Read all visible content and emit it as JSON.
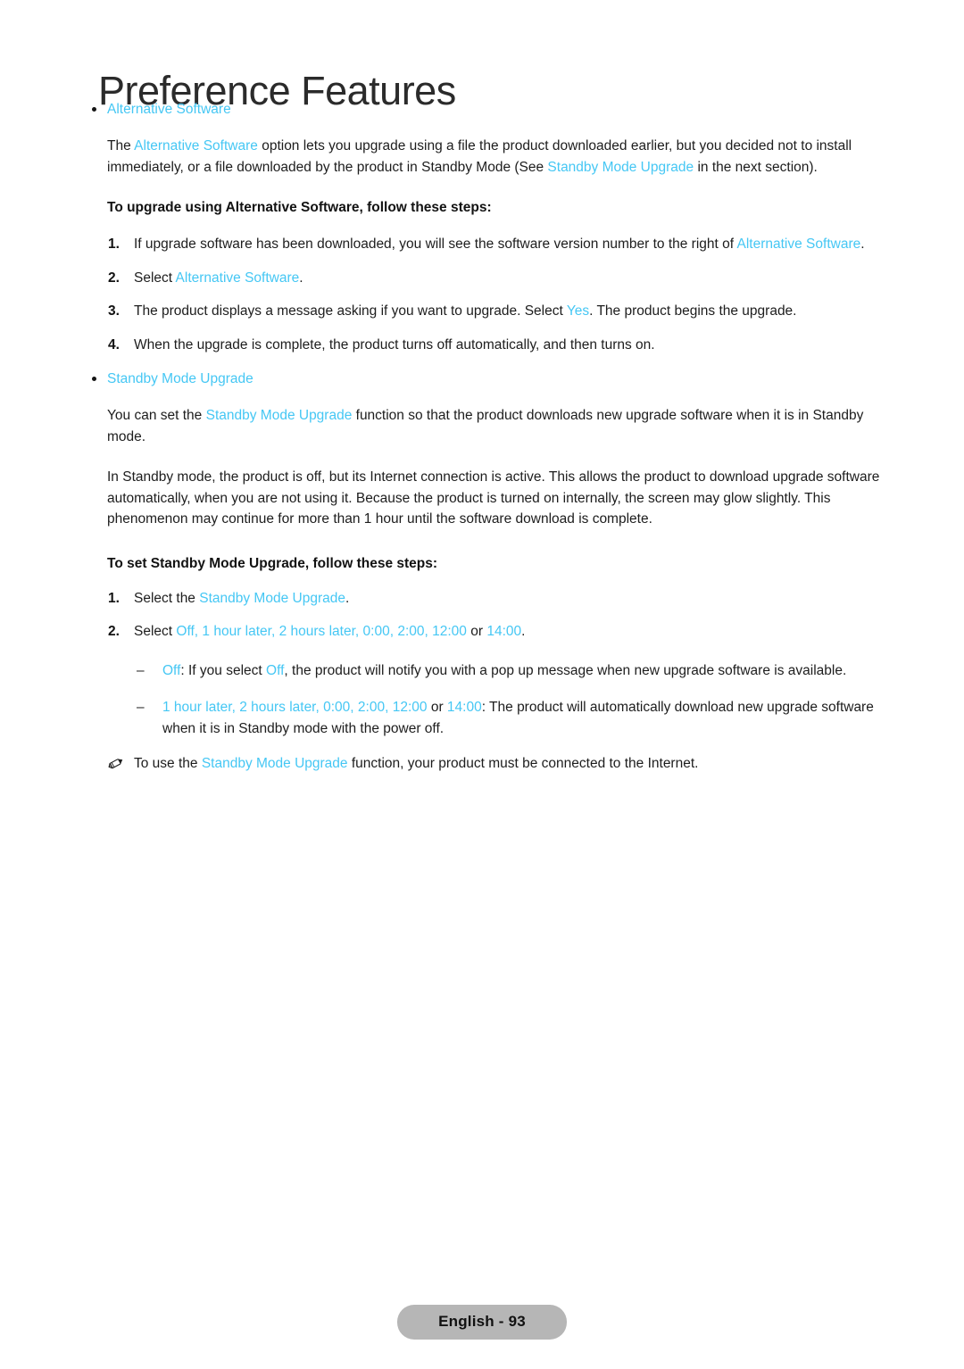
{
  "document": {
    "title": "Preference Features",
    "accent_color": "#45c7f4",
    "text_color": "#1d1d1d",
    "background_color": "#ffffff"
  },
  "terms": {
    "alternative_software": "Alternative Software",
    "standby_mode_upgrade": "Standby Mode Upgrade",
    "yes": "Yes",
    "off": "Off",
    "one_hour_later": "1 hour later",
    "two_hours_later": "2 hours later",
    "t0000": "0:00",
    "t0200": "2:00",
    "t1200": "12:00",
    "t1400": "14:00"
  },
  "sections": [
    {
      "heading": "Alternative Software",
      "intro": {
        "p1": "The ",
        "p2": " option lets you upgrade using a file the product downloaded earlier, but you decided not to install immediately, or a file downloaded by the product in Standby Mode (See ",
        "p3": " in the next section)."
      },
      "steps_title": "To upgrade using Alternative Software, follow these steps:",
      "steps": [
        {
          "num": "1.",
          "a": "If upgrade software has been downloaded, you will see the software version number to the right of ",
          "b": "Alternative Software",
          "c": "."
        },
        {
          "num": "2.",
          "a": "Select ",
          "b": "Alternative Software",
          "c": "."
        },
        {
          "num": "3.",
          "a": "The product displays a message asking if you want to upgrade. Select ",
          "b": "Yes",
          "c": ". The product begins the upgrade."
        },
        {
          "num": "4.",
          "a": "When the upgrade is complete, the product turns off automatically, and then turns on.",
          "b": "",
          "c": ""
        }
      ]
    },
    {
      "heading": "Standby Mode Upgrade",
      "para1": {
        "p1": "You can set the ",
        "p2": "Standby Mode Upgrade",
        "p3": " function so that the product downloads new upgrade software when it is in Standby mode."
      },
      "para2": "In Standby mode, the product is off, but its Internet connection is active. This allows the product to download upgrade software automatically, when you are not using it. Because the product is turned on internally, the screen may glow slightly. This phenomenon may continue for more than 1 hour until the software download is complete.",
      "steps_title": "To set Standby Mode Upgrade, follow these steps:",
      "step1": {
        "num": "1.",
        "a": "Select the ",
        "b": "Standby Mode Upgrade",
        "c": "."
      },
      "step2": {
        "num": "2.",
        "lead": "Select ",
        "sep": ", ",
        "or": " or ",
        "end": "."
      },
      "sub_items": [
        {
          "dash": "–",
          "term": "Off",
          "mid1": ": If you select ",
          "term2": "Off",
          "tail": ", the product will notify you with a pop up message when new upgrade software is available."
        },
        {
          "dash": "–",
          "tail": ": The product will automatically download new upgrade software when it is in Standby mode with the power off."
        }
      ],
      "note": {
        "icon": "pencil-note-icon",
        "a": "To use the ",
        "b": "Standby Mode Upgrade",
        "c": " function, your product must be connected to the Internet."
      }
    }
  ],
  "footer": {
    "page_label": "English - 93"
  }
}
